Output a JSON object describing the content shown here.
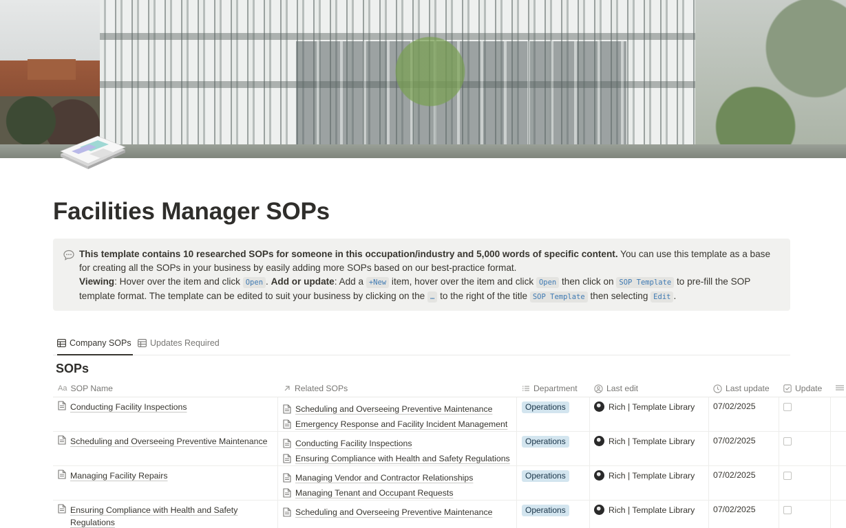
{
  "page": {
    "title": "Facilities Manager SOPs"
  },
  "callout": {
    "icon": "speech-bubble-icon",
    "line1_bold": "This template contains 10 researched SOPs for someone in this occupation/industry and 5,000 words of specific content.",
    "line1_rest": " You can use this template as a base for creating all the SOPs in your business by easily adding more SOPs based on our best-practice format.",
    "viewing_label": "Viewing",
    "viewing_text": ": Hover over the item and click ",
    "open_code": "Open",
    "sep": ". ",
    "add_label": "Add or update",
    "add_text": ": Add a ",
    "new_code": "+New",
    "add_text2": " item, hover over the item and click ",
    "open_code2": "Open",
    "add_text3": " then click on ",
    "template_code": "SOP Template",
    "add_text4": " to pre-fill the SOP template format. The template can be edited to suit your business by clicking on the ",
    "dots_code": "…",
    "add_text5": " to the right of the title ",
    "template_code2": "SOP Template",
    "add_text6": " then selecting ",
    "edit_code": "Edit",
    "end": "."
  },
  "tabs": [
    {
      "label": "Company SOPs",
      "active": true
    },
    {
      "label": "Updates Required",
      "active": false
    }
  ],
  "table": {
    "title": "SOPs",
    "columns": {
      "name": "SOP Name",
      "related": "Related SOPs",
      "department": "Department",
      "last_edit": "Last edit",
      "last_update": "Last update",
      "update": "Update"
    },
    "rows": [
      {
        "name": "Conducting Facility Inspections",
        "related": [
          "Scheduling and Overseeing Preventive Maintenance",
          "Emergency Response and Facility Incident Management"
        ],
        "department": "Operations",
        "last_edit": "Rich | Template Library",
        "last_update": "07/02/2025",
        "update": false
      },
      {
        "name": "Scheduling and Overseeing Preventive Maintenance",
        "related": [
          "Conducting Facility Inspections",
          "Ensuring Compliance with Health and Safety Regulations"
        ],
        "department": "Operations",
        "last_edit": "Rich | Template Library",
        "last_update": "07/02/2025",
        "update": false
      },
      {
        "name": "Managing Facility Repairs",
        "related": [
          "Managing Vendor and Contractor Relationships",
          "Managing Tenant and Occupant Requests"
        ],
        "department": "Operations",
        "last_edit": "Rich | Template Library",
        "last_update": "07/02/2025",
        "update": false
      },
      {
        "name": "Ensuring Compliance with Health and Safety Regulations",
        "related": [
          "Scheduling and Overseeing Preventive Maintenance"
        ],
        "department": "Operations",
        "last_edit": "Rich | Template Library",
        "last_update": "07/02/2025",
        "update": false
      }
    ]
  },
  "colors": {
    "tag_bg": "#d3e5ef",
    "code_text": "#3f7ab3",
    "callout_bg": "#f1f1ef"
  }
}
